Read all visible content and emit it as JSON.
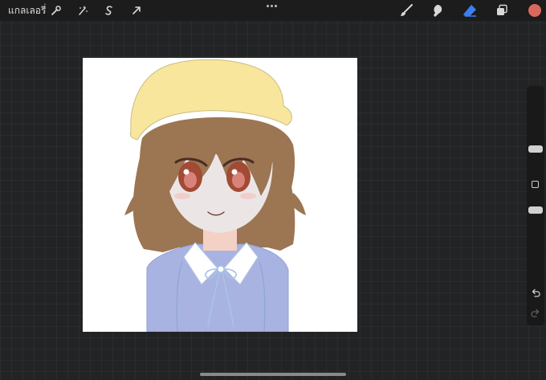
{
  "topbar": {
    "gallery_label": "แกลเลอรี่",
    "left_tools": [
      "wrench-icon",
      "magic-wand-icon",
      "selection-icon",
      "transform-arrow-icon"
    ],
    "right_tools": [
      "brush-icon",
      "smudge-icon",
      "eraser-icon",
      "layers-icon"
    ],
    "active_tool": "eraser-icon",
    "current_color": "#d9685e",
    "accent_color": "#3d7ff0"
  },
  "sidebar": {
    "brush_size_level": 0.3,
    "opacity_level": 0.68,
    "icons": [
      "modify-square-icon",
      "undo-icon",
      "redo-icon"
    ]
  },
  "canvas": {
    "background": "#ffffff",
    "artwork": "chibi-girl-yellow-hat"
  }
}
